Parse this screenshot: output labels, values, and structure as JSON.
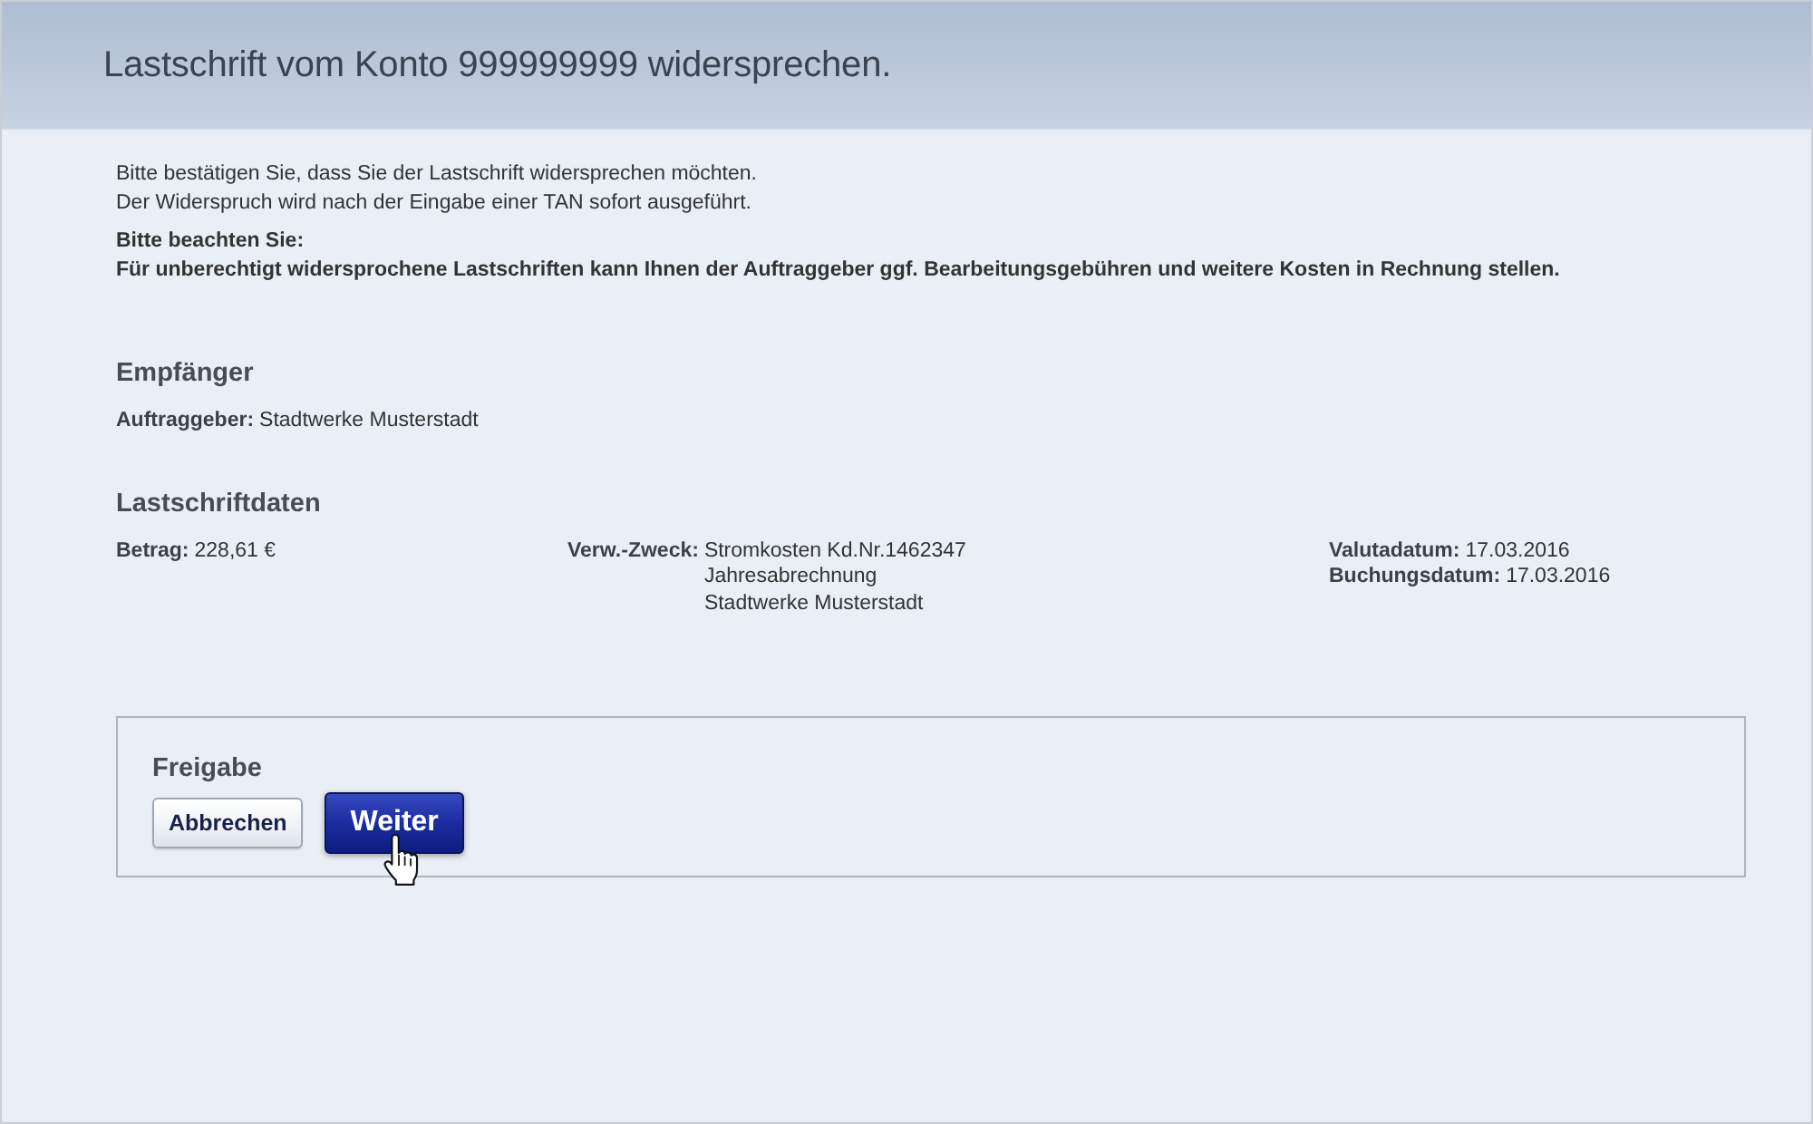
{
  "header": {
    "title": "Lastschrift vom Konto 999999999 widersprechen."
  },
  "intro": {
    "lines": [
      "Bitte bestätigen Sie, dass Sie der Lastschrift widersprechen möchten.",
      "Der Widerspruch wird nach der Eingabe einer TAN sofort ausgeführt."
    ],
    "notice_title": "Bitte beachten Sie:",
    "notice_text": "Für unberechtigt widersprochene Lastschriften kann Ihnen der Auftraggeber ggf. Bearbeitungsgebühren und weitere Kosten in Rechnung stellen."
  },
  "recipient": {
    "heading": "Empfänger",
    "fields": [
      {
        "label": "Auftraggeber:",
        "value_lines": [
          "Stadtwerke Musterstadt"
        ]
      }
    ]
  },
  "debit_data": {
    "heading": "Lastschriftdaten",
    "columns": [
      {
        "fields": [
          {
            "label": "Betrag:",
            "value_lines": [
              "228,61 €"
            ]
          }
        ]
      },
      {
        "fields": [
          {
            "label": "Verw.-Zweck:",
            "value_lines": [
              "Stromkosten Kd.Nr.1462347",
              "Jahresabrechnung",
              "Stadtwerke Musterstadt"
            ]
          }
        ]
      },
      {
        "fields": [
          {
            "label": "Valutadatum:",
            "value_lines": [
              "17.03.2016"
            ]
          },
          {
            "label": "Buchungsdatum:",
            "value_lines": [
              "17.03.2016"
            ]
          }
        ]
      }
    ]
  },
  "release": {
    "heading": "Freigabe",
    "buttons": [
      {
        "label": "Abbrechen",
        "kind": "secondary",
        "hovered": false
      },
      {
        "label": "Weiter",
        "kind": "primary",
        "hovered": true
      }
    ]
  }
}
